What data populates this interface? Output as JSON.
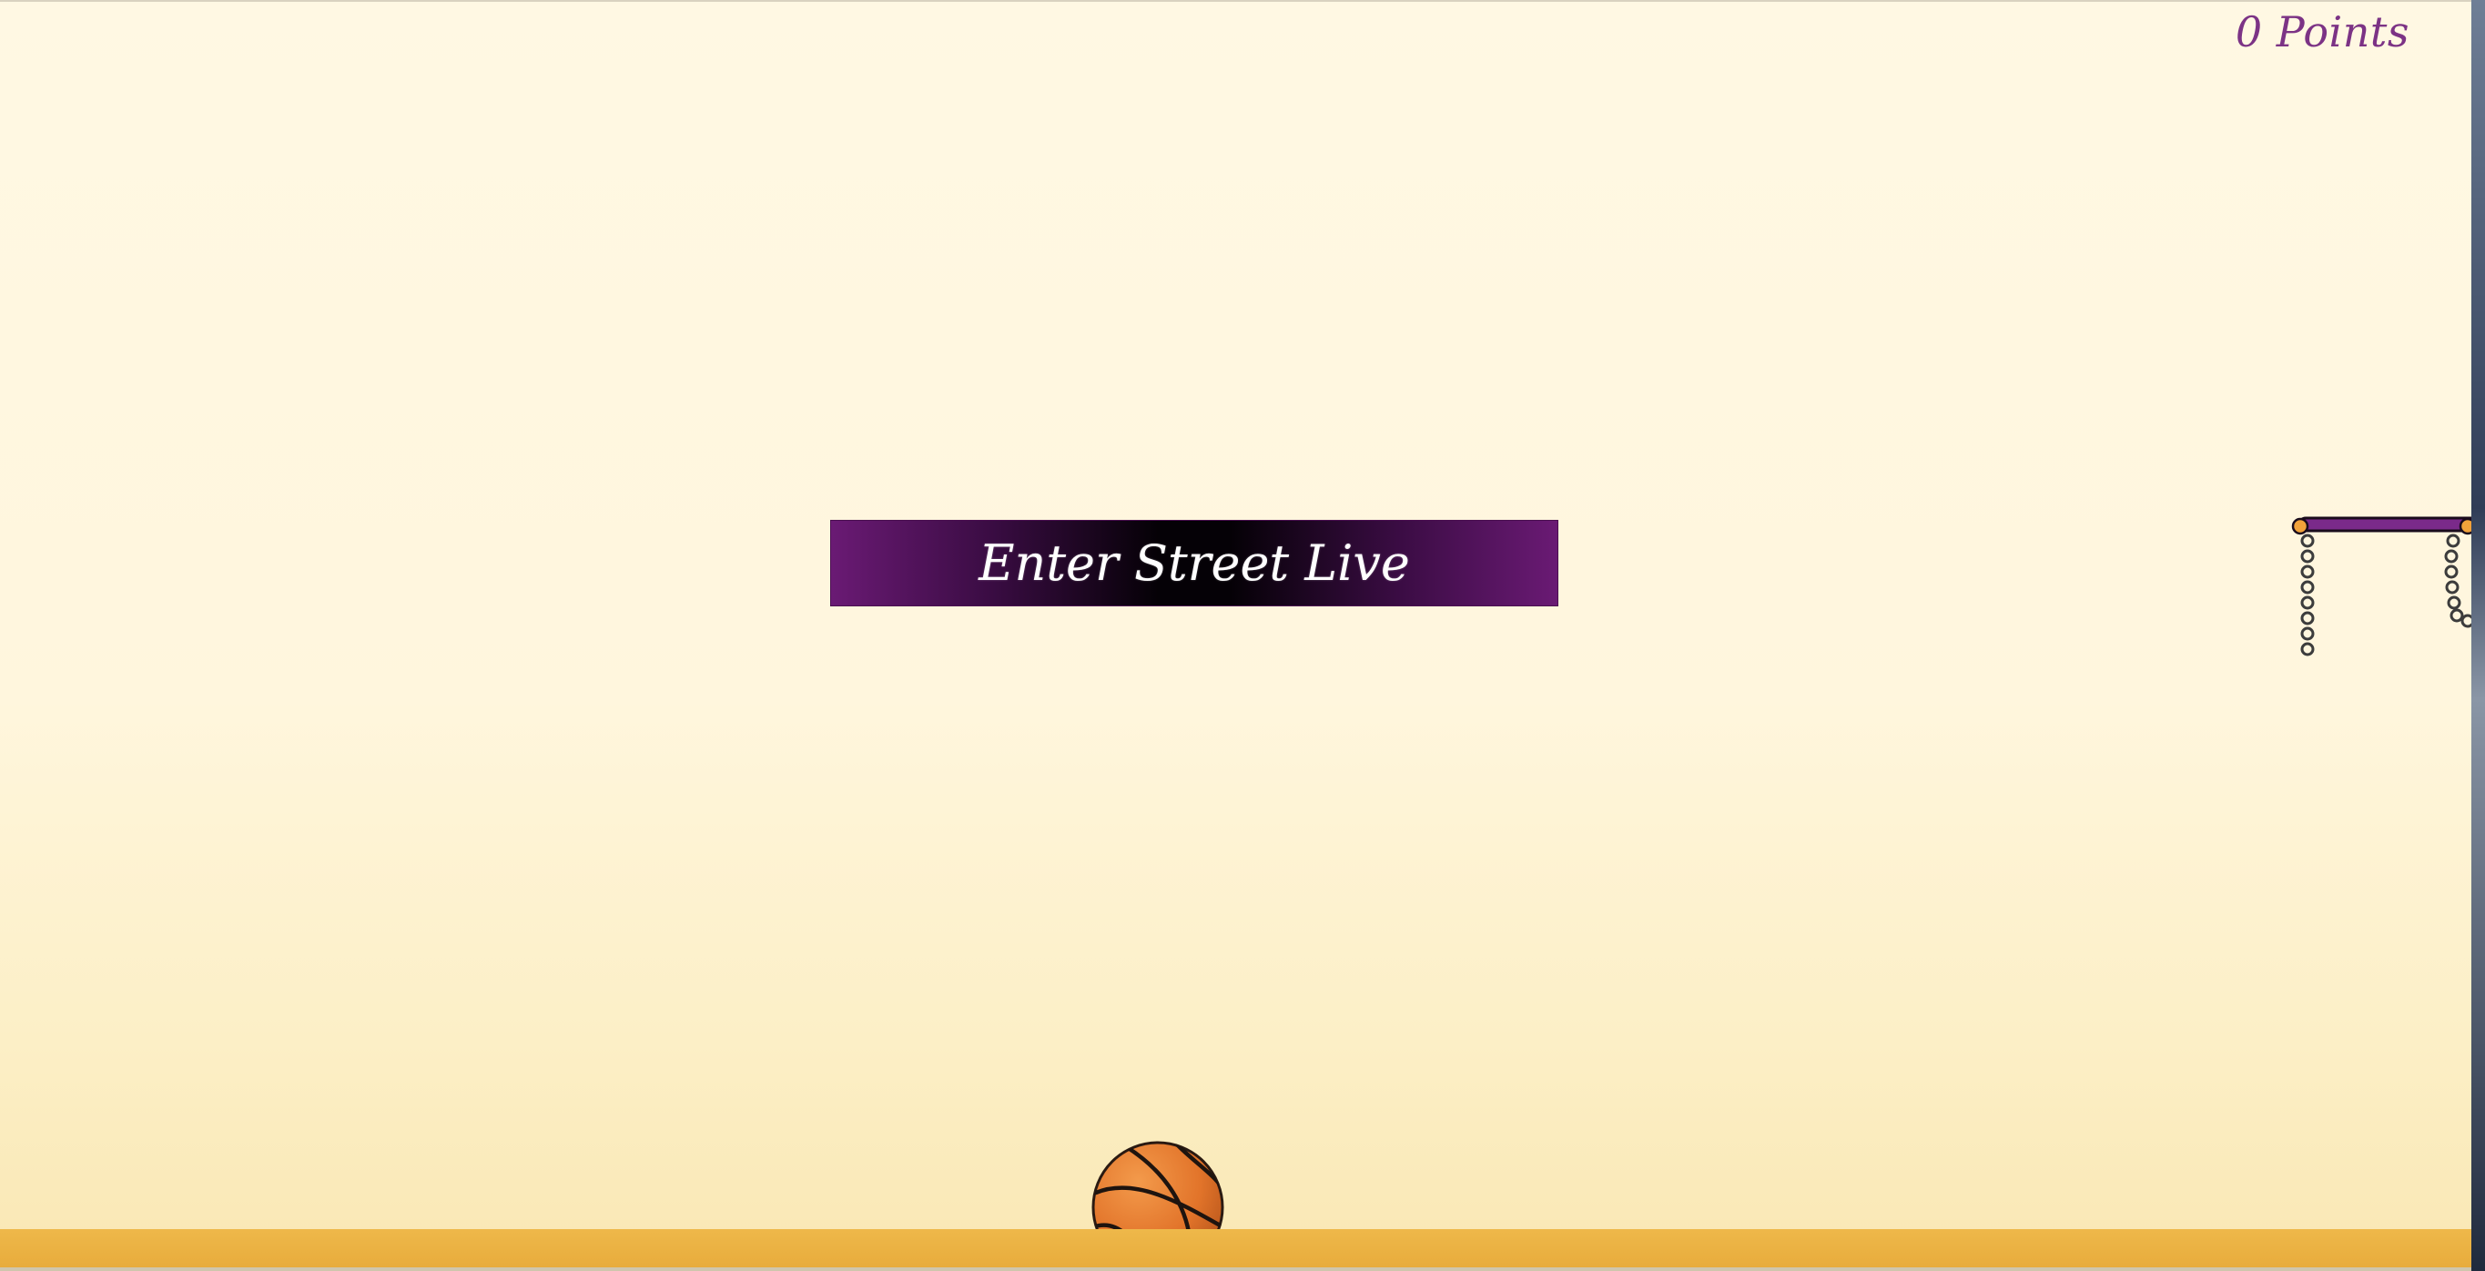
{
  "score": {
    "text": "0 Points"
  },
  "menu": {
    "enter_button_label": "Enter Street Live"
  },
  "colors": {
    "background": "#fff8e3",
    "floor": "#eeb84a",
    "accent_purple": "#7c3385",
    "button_dark": "#050106",
    "ball": "#e87a2e"
  },
  "icons": {
    "ball": "basketball-icon",
    "hoop": "hoop-icon"
  }
}
